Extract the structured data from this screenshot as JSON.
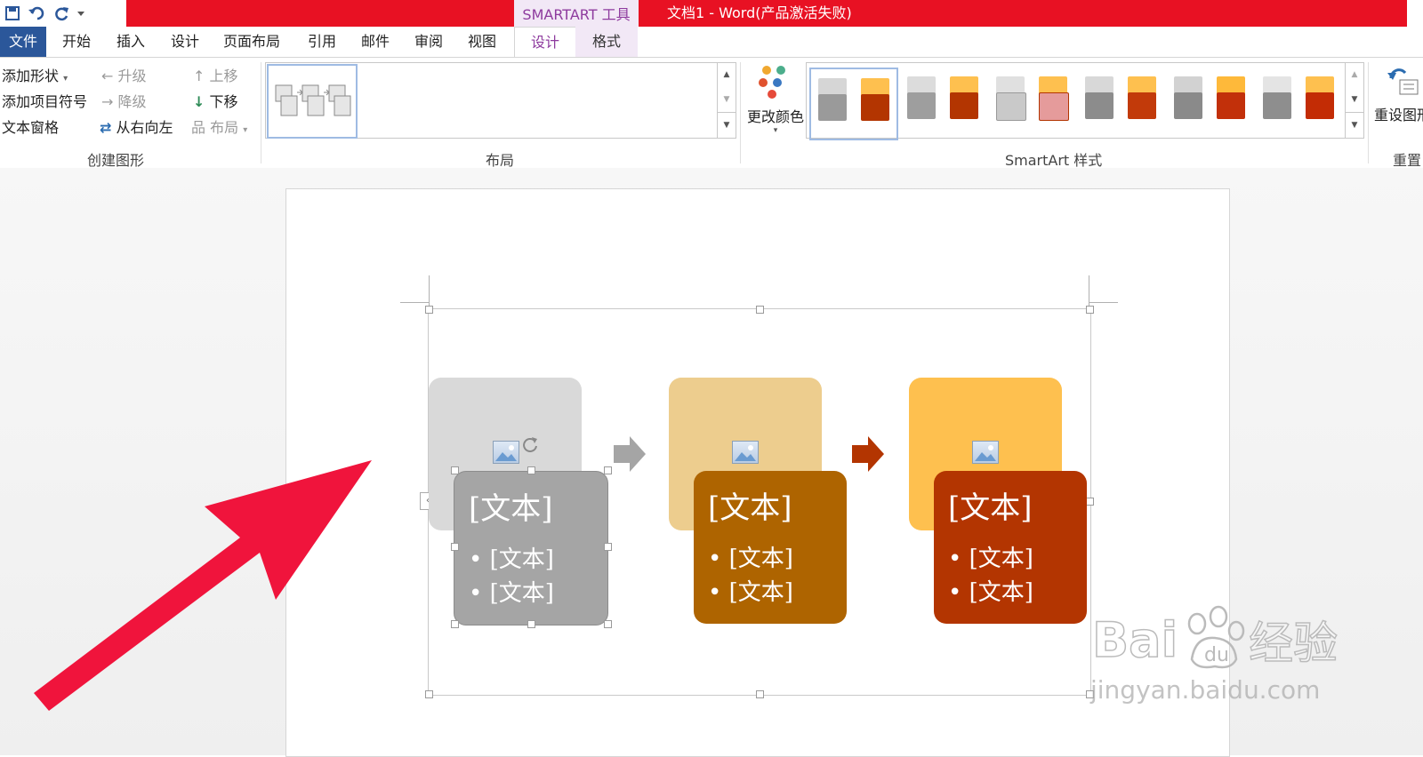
{
  "app": {
    "contextual_tab": "SMARTART 工具",
    "title": "文档1 - Word(产品激活失败)"
  },
  "tabs": {
    "file": "文件",
    "items": [
      "开始",
      "插入",
      "设计",
      "页面布局",
      "引用",
      "邮件",
      "审阅",
      "视图"
    ],
    "context_design": "设计",
    "context_format": "格式"
  },
  "ribbon": {
    "create": {
      "add_shape": "添加形状",
      "add_bullet": "添加项目符号",
      "text_pane": "文本窗格",
      "promote": "升级",
      "demote": "降级",
      "right_to_left": "从右向左",
      "move_up": "上移",
      "move_down": "下移",
      "layout": "布局",
      "label": "创建图形"
    },
    "layouts": {
      "label": "布局"
    },
    "styles": {
      "change_colors": "更改颜色",
      "label": "SmartArt 样式"
    },
    "reset": {
      "button": "重设图形",
      "label": "重置"
    }
  },
  "smartart": {
    "items": [
      {
        "title": "[文本]",
        "bullets": [
          "[文本]",
          "[文本]"
        ],
        "back_color": "#d9d9d9",
        "front_color": "#a5a5a5"
      },
      {
        "title": "[文本]",
        "bullets": [
          "[文本]",
          "[文本]"
        ],
        "back_color": "#edcd8e",
        "front_color": "#ae6400"
      },
      {
        "title": "[文本]",
        "bullets": [
          "[文本]",
          "[文本]"
        ],
        "back_color": "#fec04f",
        "front_color": "#b33501"
      }
    ],
    "arrow_colors": [
      "#a5a5a5",
      "#b33501"
    ]
  },
  "watermark": {
    "brand": "Bai",
    "brand2": "经验",
    "url": "jingyan.baidu.com"
  },
  "colors": {
    "title_red": "#e81123",
    "file_blue": "#2b579a",
    "accent_purple": "#8e3b9e",
    "callout_arrow": "#f0143c"
  }
}
